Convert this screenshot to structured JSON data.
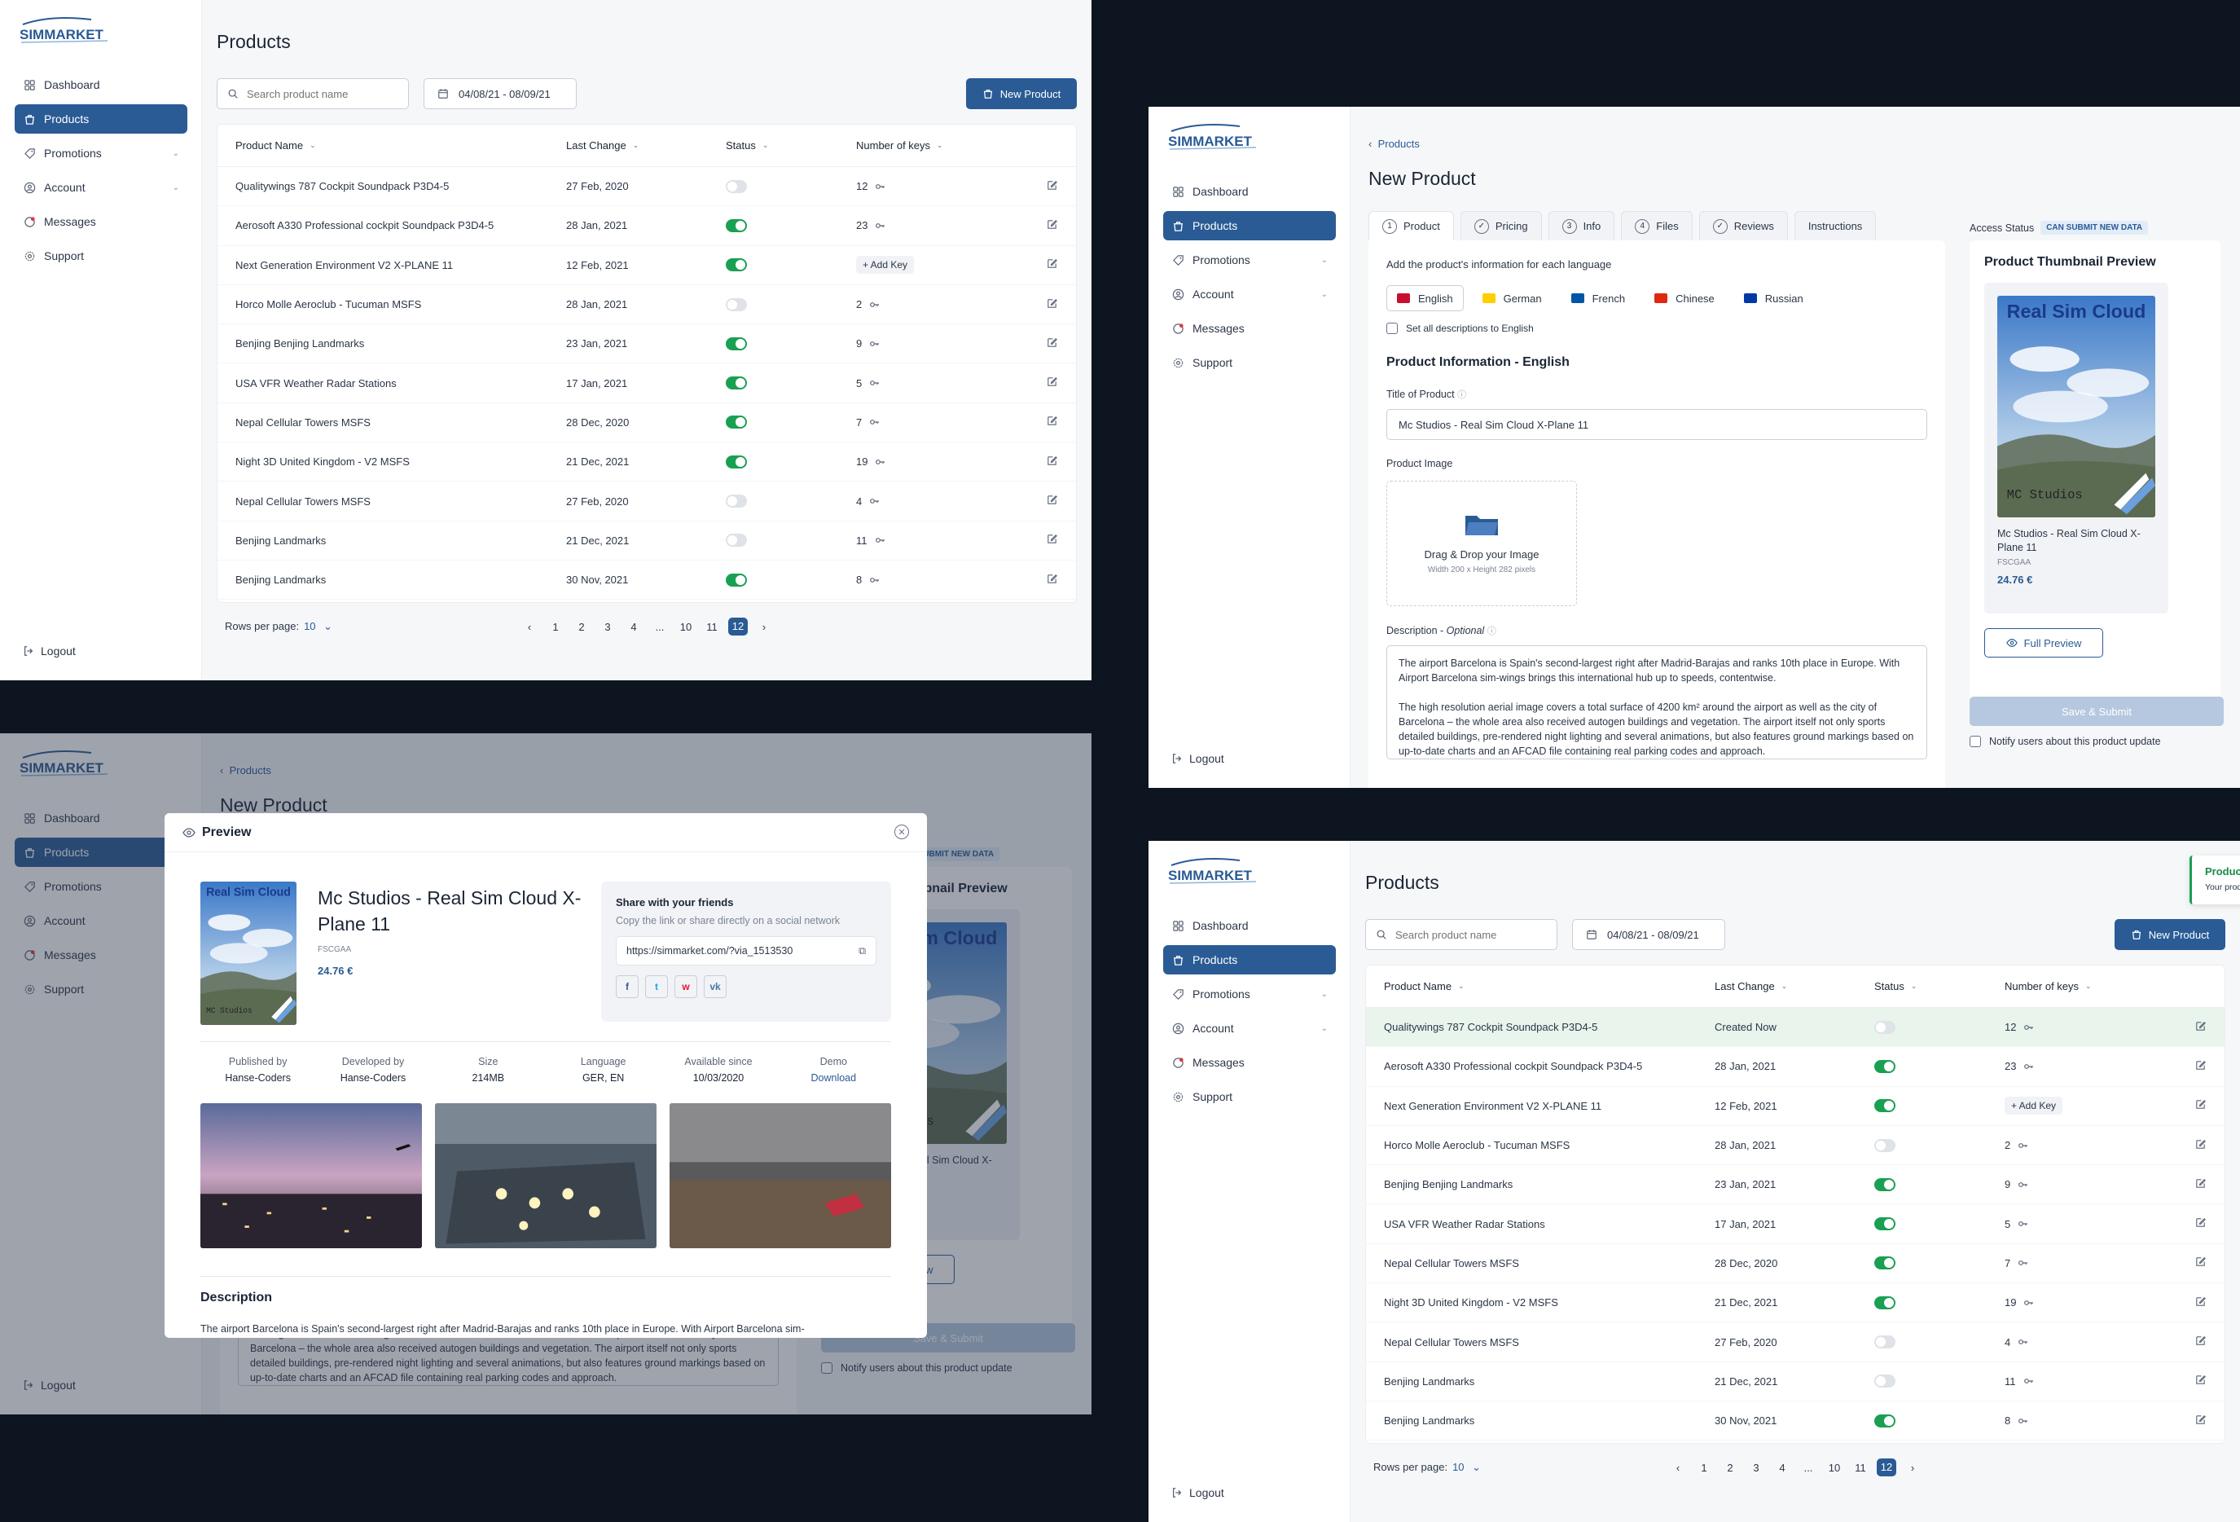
{
  "brand": {
    "logo_text": "SIMMARKET",
    "accent": "#2a5b95",
    "success": "#1aa053"
  },
  "nav": {
    "items": [
      {
        "label": "Dashboard",
        "icon": "dashboard-icon"
      },
      {
        "label": "Products",
        "icon": "bag-icon"
      },
      {
        "label": "Promotions",
        "icon": "tag-icon"
      },
      {
        "label": "Account",
        "icon": "user-icon"
      },
      {
        "label": "Messages",
        "icon": "chat-icon"
      },
      {
        "label": "Support",
        "icon": "gear-icon"
      }
    ],
    "logout": "Logout"
  },
  "products": {
    "title": "Products",
    "search_placeholder": "Search product name",
    "date_range": "04/08/21 - 08/09/21",
    "new_button": "New Product",
    "columns": [
      "Product Name",
      "Last Change",
      "Status",
      "Number of keys"
    ],
    "rows": [
      {
        "name": "Qualitywings 787 Cockpit Soundpack P3D4-5",
        "date": "27 Feb, 2020",
        "on": false,
        "keys": "12"
      },
      {
        "name": "Aerosoft A330 Professional cockpit Soundpack P3D4-5",
        "date": "28 Jan, 2021",
        "on": true,
        "keys": "23"
      },
      {
        "name": "Next Generation Environment V2 X-PLANE 11",
        "date": "12 Feb, 2021",
        "on": true,
        "keys": "+ Add Key"
      },
      {
        "name": "Horco Molle Aeroclub - Tucuman MSFS",
        "date": "28 Jan, 2021",
        "on": false,
        "keys": "2"
      },
      {
        "name": "Benjing Benjing Landmarks",
        "date": "23 Jan, 2021",
        "on": true,
        "keys": "9"
      },
      {
        "name": "USA VFR Weather Radar Stations",
        "date": "17 Jan, 2021",
        "on": true,
        "keys": "5"
      },
      {
        "name": "Nepal Cellular Towers  MSFS",
        "date": "28 Dec, 2020",
        "on": true,
        "keys": "7"
      },
      {
        "name": "Night 3D United Kingdom  - V2 MSFS",
        "date": "21 Dec, 2021",
        "on": true,
        "keys": "19"
      },
      {
        "name": "Nepal Cellular Towers  MSFS",
        "date": "27 Feb, 2020",
        "on": false,
        "keys": "4"
      },
      {
        "name": "Benjing Landmarks",
        "date": "21 Dec, 2021",
        "on": false,
        "keys": "11"
      },
      {
        "name": "Benjing Landmarks",
        "date": "30 Nov, 2021",
        "on": true,
        "keys": "8"
      }
    ],
    "first_row_date_after": "Created Now",
    "rows_per_page_label": "Rows per page:",
    "rows_per_page": "10",
    "pages": [
      "1",
      "2",
      "3",
      "4",
      "...",
      "10",
      "11",
      "12"
    ],
    "current_page": "12"
  },
  "new_product": {
    "breadcrumb": "Products",
    "title": "New Product",
    "tabs": [
      {
        "num": "1",
        "label": "Product"
      },
      {
        "num": "✓",
        "label": "Pricing"
      },
      {
        "num": "3",
        "label": "Info"
      },
      {
        "num": "4",
        "label": "Files"
      },
      {
        "num": "✓",
        "label": "Reviews"
      },
      {
        "num": "",
        "label": "Instructions"
      }
    ],
    "instruction": "Add the product's information for each language",
    "languages": [
      {
        "label": "English",
        "color": "#c8102e"
      },
      {
        "label": "German",
        "color": "#ffce00"
      },
      {
        "label": "French",
        "color": "#0055a4"
      },
      {
        "label": "Chinese",
        "color": "#de2910"
      },
      {
        "label": "Russian",
        "color": "#0039a6"
      }
    ],
    "set_all": "Set all descriptions to English",
    "section": "Product Information - English",
    "title_label": "Title of Product",
    "title_value": "Mc Studios - Real Sim Cloud X-Plane 11",
    "image_label": "Product Image",
    "drop_text": "Drag & Drop your Image",
    "drop_hint": "Width 200 x Height 282 pixels",
    "desc_label": "Description - ",
    "desc_optional": "Optional",
    "desc_p1": "The airport Barcelona is Spain's second-largest right after Madrid-Barajas and ranks 10th place in Europe. With Airport Barcelona sim-wings brings this international hub up to speeds, contentwise.",
    "desc_p2": "The high resolution aerial image covers a total surface of 4200 km² around the airport as well as the city of Barcelona – the whole area also received autogen buildings and vegetation. The airport itself not only sports detailed buildings, pre-rendered night lighting and several animations, but also features ground markings based on up-to-date charts and an AFCAD file containing real parking codes and approach.",
    "access_label": "Access Status",
    "access_badge": "CAN SUBMIT NEW DATA",
    "thumb_title": "Product Thumbnail Preview",
    "cover_title": "Real Sim Cloud",
    "cover_brand": "MC Studios",
    "thumb_name": "Mc Studios - Real Sim Cloud X-Plane 11",
    "thumb_sku": "FSCGAA",
    "thumb_price": "24.76 €",
    "full_preview": "Full Preview",
    "submit": "Save & Submit",
    "notify": "Notify users about this product update"
  },
  "preview": {
    "title": "Preview",
    "product_title": "Mc Studios - Real Sim Cloud X-Plane 11",
    "sku": "FSCGAA",
    "price": "24.76 €",
    "share_title": "Share with your friends",
    "share_sub": "Copy the link or share directly on a social network",
    "link": "https://simmarket.com/?via_1513530",
    "socials": [
      "f",
      "t",
      "w",
      "vk"
    ],
    "meta": [
      {
        "k": "Published by",
        "v": "Hanse-Coders"
      },
      {
        "k": "Developed by",
        "v": "Hanse-Coders"
      },
      {
        "k": "Size",
        "v": "214MB"
      },
      {
        "k": "Language",
        "v": "GER, EN"
      },
      {
        "k": "Available since",
        "v": "10/03/2020"
      },
      {
        "k": "Demo",
        "v": "Download"
      }
    ],
    "desc_title": "Description",
    "desc_text": "The airport Barcelona is Spain's second-largest right after Madrid-Barajas and ranks 10th place in Europe. With Airport Barcelona sim-"
  },
  "toast": {
    "title": "Product Created",
    "message": "Your product was created sucessfuly"
  }
}
